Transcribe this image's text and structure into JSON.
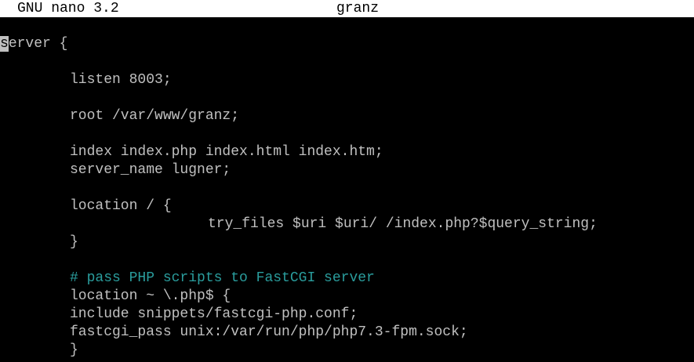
{
  "titlebar": {
    "app": "GNU nano 3.2",
    "filename": "granz"
  },
  "colors": {
    "background": "#000000",
    "text": "#c0c0c0",
    "comment": "#2a9d9d",
    "titlebar_bg": "#ffffff",
    "titlebar_text": "#000000"
  },
  "cursor": {
    "line": 1,
    "column": 1,
    "char": "s"
  },
  "editor": {
    "lines": [
      {
        "text": "server {",
        "indent": 0
      },
      {
        "text": "",
        "indent": 0
      },
      {
        "text": "listen 8003;",
        "indent": 1
      },
      {
        "text": "",
        "indent": 0
      },
      {
        "text": "root /var/www/granz;",
        "indent": 1
      },
      {
        "text": "",
        "indent": 0
      },
      {
        "text": "index index.php index.html index.htm;",
        "indent": 1
      },
      {
        "text": "server_name lugner;",
        "indent": 1
      },
      {
        "text": "",
        "indent": 0
      },
      {
        "text": "location / {",
        "indent": 1
      },
      {
        "text": "try_files $uri $uri/ /index.php?$query_string;",
        "indent": 3
      },
      {
        "text": "}",
        "indent": 1
      },
      {
        "text": "",
        "indent": 0
      },
      {
        "text": "# pass PHP scripts to FastCGI server",
        "indent": 1,
        "comment": true
      },
      {
        "text": "location ~ \\.php$ {",
        "indent": 1
      },
      {
        "text": "include snippets/fastcgi-php.conf;",
        "indent": 1
      },
      {
        "text": "fastcgi_pass unix:/var/run/php/php7.3-fpm.sock;",
        "indent": 1
      },
      {
        "text": "}",
        "indent": 1
      }
    ]
  }
}
